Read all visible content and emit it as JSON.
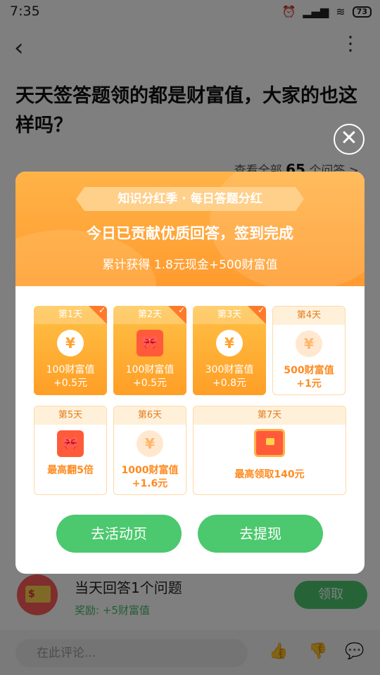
{
  "status": {
    "time": "7:35",
    "battery": "73"
  },
  "question": {
    "title": "天天签答题领的都是财富值，大家的也这样吗？",
    "view_all_prefix": "查看全部",
    "view_all_count": "65",
    "view_all_suffix": "个问答 >"
  },
  "task": {
    "title": "当天回答1个问题",
    "reward": "奖励: +5财富值",
    "claim": "领取"
  },
  "comment": {
    "placeholder": "在此评论..."
  },
  "modal": {
    "ribbon": "知识分红季 · 每日答题分红",
    "headline": "今日已贡献优质回答，签到完成",
    "subline": "累计获得 1.8元现金+500财富值",
    "days": [
      {
        "label": "第1天",
        "line1": "100财富值",
        "line2": "+0.5元"
      },
      {
        "label": "第2天",
        "line1": "100财富值",
        "line2": "+0.5元"
      },
      {
        "label": "第3天",
        "line1": "300财富值",
        "line2": "+0.8元"
      },
      {
        "label": "第4天",
        "line1": "500财富值",
        "line2": "+1元"
      },
      {
        "label": "第5天",
        "line1": "最高翻5倍",
        "line2": ""
      },
      {
        "label": "第6天",
        "line1": "1000财富值",
        "line2": "+1.6元"
      },
      {
        "label": "第7天",
        "line1": "最高领取140元",
        "line2": ""
      }
    ],
    "btn_activity": "去活动页",
    "btn_withdraw": "去提现"
  },
  "colors": {
    "accent_orange": "#ff9b2f",
    "green": "#4cc86e"
  }
}
